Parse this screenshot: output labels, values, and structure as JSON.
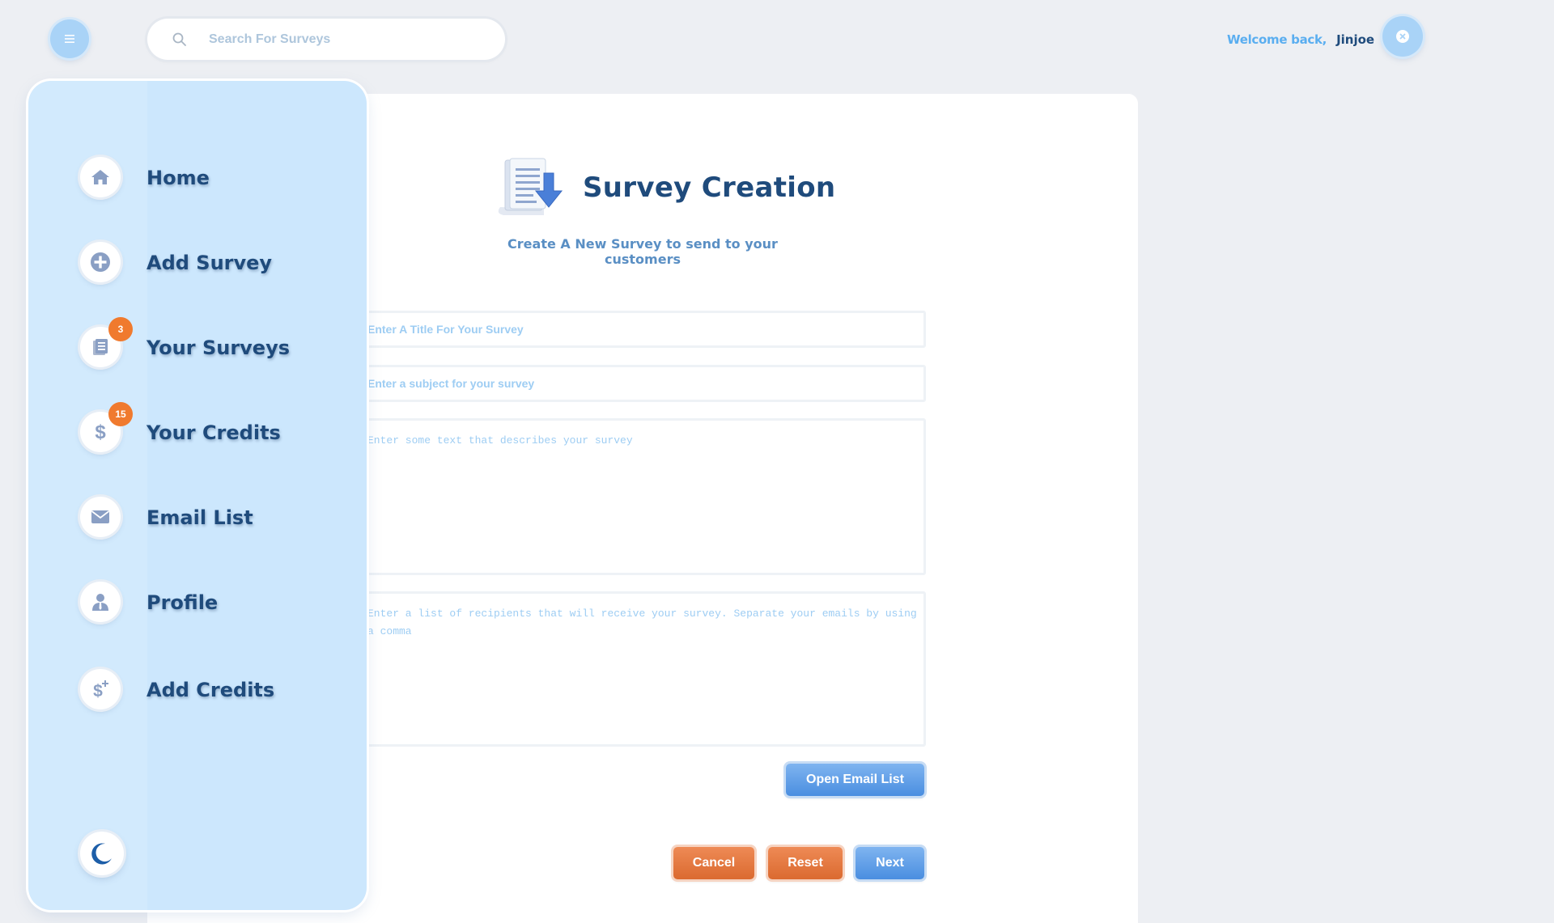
{
  "header": {
    "search_placeholder": "Search For Surveys",
    "welcome_label": "Welcome back,",
    "user_name": "Jinjoe"
  },
  "sidebar": {
    "items": [
      {
        "label": "Home",
        "icon": "home-icon"
      },
      {
        "label": "Add Survey",
        "icon": "plus-circle-icon"
      },
      {
        "label": "Your Surveys",
        "icon": "document-list-icon",
        "badge": "3"
      },
      {
        "label": "Your Credits",
        "icon": "dollar-icon",
        "badge": "15"
      },
      {
        "label": "Email List",
        "icon": "envelope-icon"
      },
      {
        "label": "Profile",
        "icon": "user-icon"
      },
      {
        "label": "Add Credits",
        "icon": "dollar-plus-icon"
      }
    ],
    "theme_toggle_icon": "moon-icon"
  },
  "main": {
    "title": "Survey Creation",
    "subtitle": "Create A New Survey to send to your customers",
    "fields": {
      "title_placeholder": "Enter A Title For Your Survey",
      "subject_placeholder": "Enter a subject for your survey",
      "description_placeholder": "Enter some text that describes your survey",
      "recipients_placeholder": "Enter a list of recipients that will receive your survey. Separate your emails by using a comma"
    },
    "buttons": {
      "open_email_list": "Open Email List",
      "cancel": "Cancel",
      "reset": "Reset",
      "next": "Next"
    }
  },
  "colors": {
    "accent_blue": "#4a8ee0",
    "accent_orange": "#db6a30",
    "sidebar_bg": "#cce7fd",
    "heading": "#1f4b7c",
    "badge": "#f07a2e"
  }
}
